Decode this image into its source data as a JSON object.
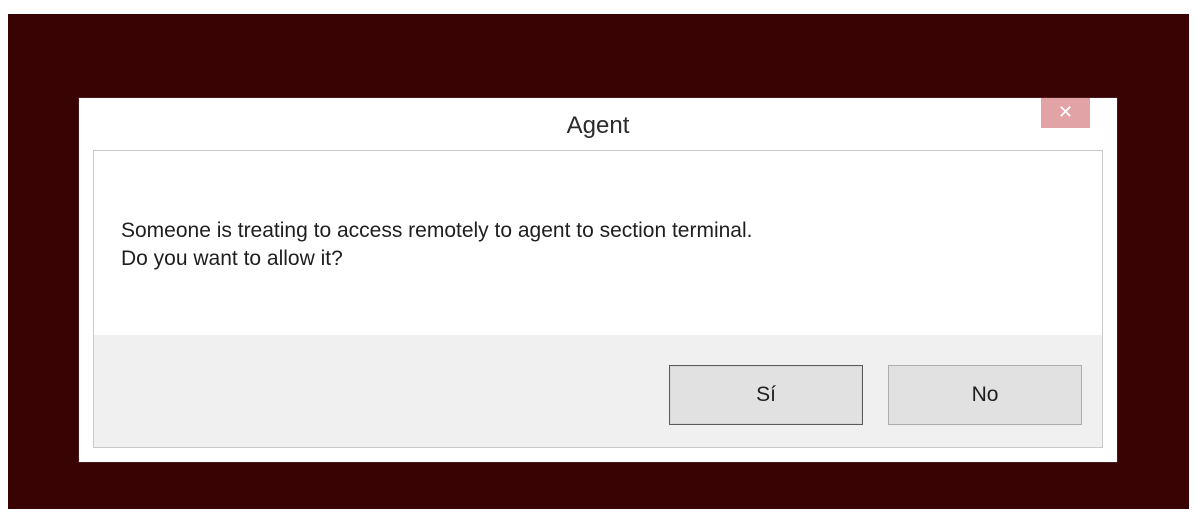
{
  "dialog": {
    "title": "Agent",
    "close_symbol": "✕",
    "message_lines": [
      "Someone is treating to access remotely to  agent to section terminal.",
      "Do you want to allow it?"
    ],
    "buttons": {
      "yes_label": "Sí",
      "no_label": "No"
    }
  },
  "colors": {
    "backdrop": "#3a0303",
    "close_button": "#e1a3a5",
    "button_area": "#f0f0f0"
  }
}
